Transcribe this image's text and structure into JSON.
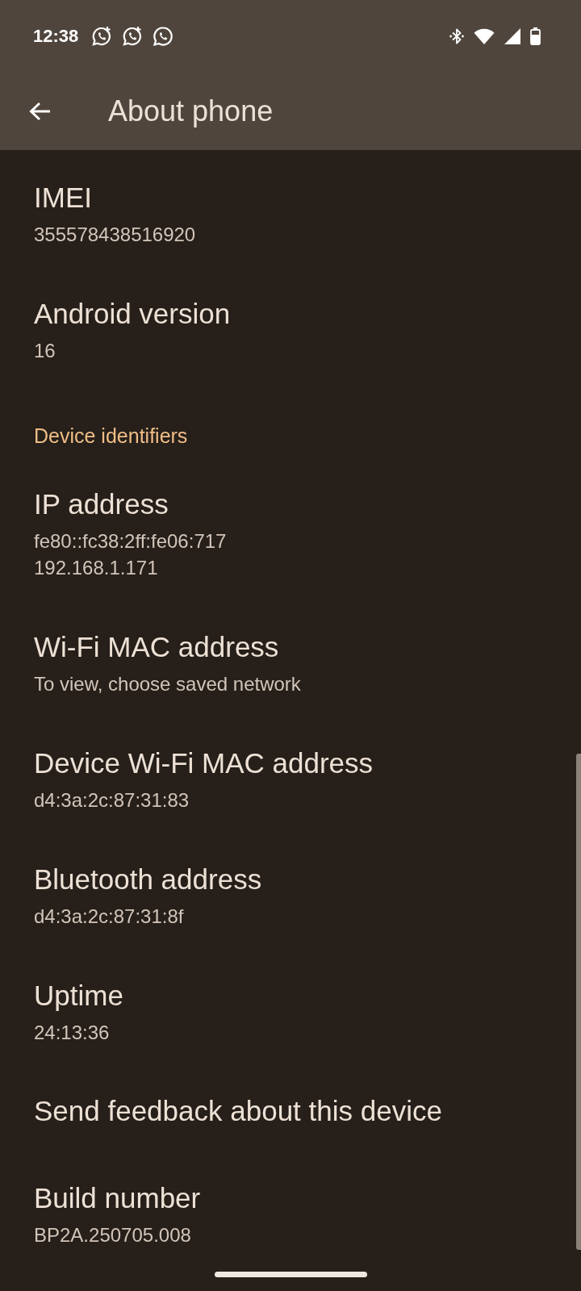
{
  "status_bar": {
    "time": "12:38"
  },
  "app_bar": {
    "title": "About phone"
  },
  "list": [
    {
      "kind": "entry",
      "title": "IMEI",
      "summary": [
        "355578438516920"
      ]
    },
    {
      "kind": "entry",
      "title": "Android version",
      "summary": [
        "16"
      ]
    },
    {
      "kind": "category",
      "title": "Device identifiers"
    },
    {
      "kind": "entry",
      "title": "IP address",
      "summary": [
        "fe80::fc38:2ff:fe06:717",
        "192.168.1.171"
      ]
    },
    {
      "kind": "entry",
      "title": "Wi-Fi MAC address",
      "summary": [
        "To view, choose saved network"
      ]
    },
    {
      "kind": "entry",
      "title": "Device Wi-Fi MAC address",
      "summary": [
        "d4:3a:2c:87:31:83"
      ]
    },
    {
      "kind": "entry",
      "title": "Bluetooth address",
      "summary": [
        "d4:3a:2c:87:31:8f"
      ]
    },
    {
      "kind": "entry",
      "title": "Uptime",
      "summary": [
        "24:13:36"
      ]
    },
    {
      "kind": "entry",
      "title": "Send feedback about this device"
    },
    {
      "kind": "entry",
      "title": "Build number",
      "summary": [
        "BP2A.250705.008"
      ]
    }
  ]
}
